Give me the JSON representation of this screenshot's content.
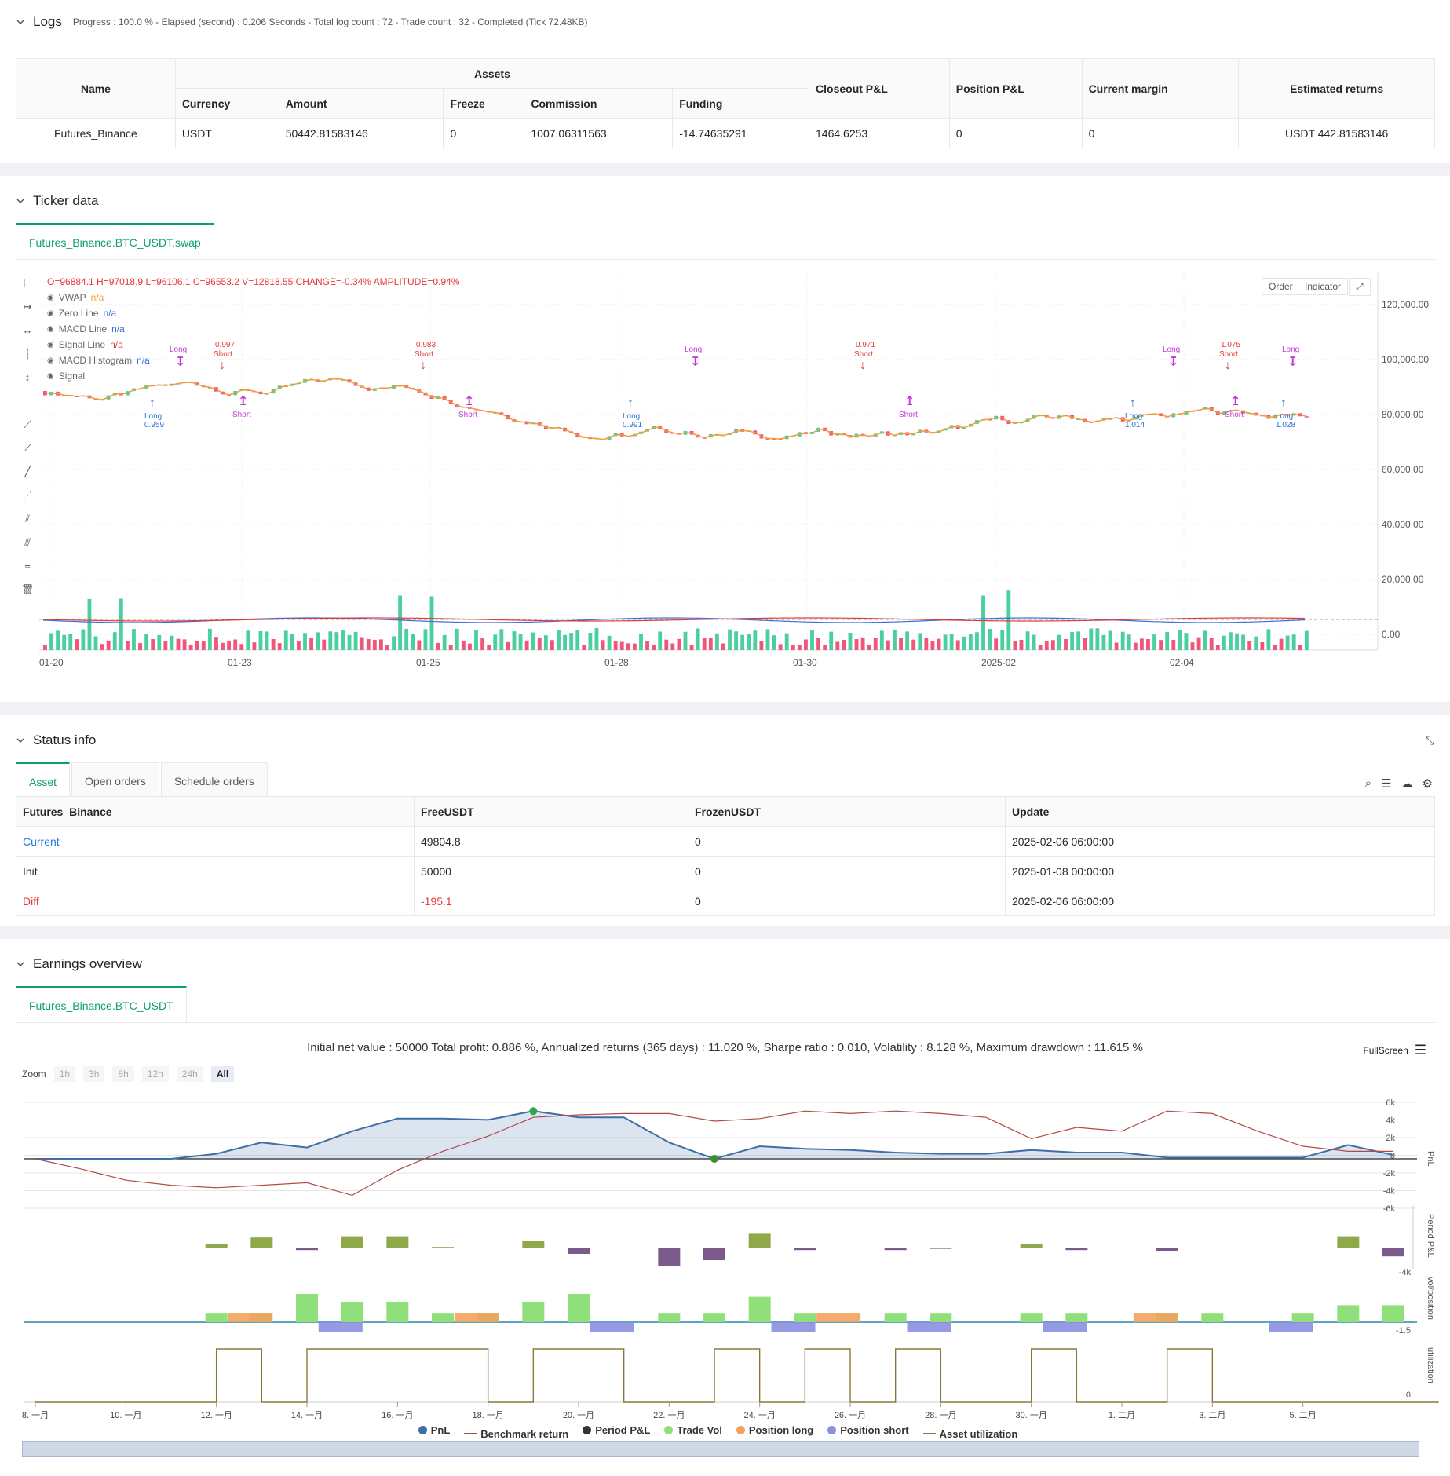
{
  "logs": {
    "title": "Logs",
    "meta": "Progress : 100.0 % - Elapsed (second) : 0.206  Seconds - Total log count : 72 - Trade count : 32 - Completed (Tick 72.48KB)"
  },
  "assets_table": {
    "group_header": "Assets",
    "headers": [
      "Name",
      "Currency",
      "Amount",
      "Freeze",
      "Commission",
      "Funding",
      "Closeout P&L",
      "Position P&L",
      "Current margin",
      "Estimated returns"
    ],
    "row": [
      "Futures_Binance",
      "USDT",
      "50442.81583146",
      "0",
      "1007.06311563",
      "-14.74635291",
      "1464.6253",
      "0",
      "0",
      "USDT 442.81583146"
    ]
  },
  "ticker": {
    "title": "Ticker data",
    "tab": "Futures_Binance.BTC_USDT.swap",
    "ohlc": "O=96884.1  H=97018.9  L=96106.1  C=96553.2  V=12818.55  CHANGE=-0.34%  AMPLITUDE=0.94%",
    "order_btn": "Order",
    "indicator_btn": "Indicator",
    "indicators": [
      {
        "name": "VWAP",
        "value": "n/a",
        "color": "#f29c38"
      },
      {
        "name": "Zero Line",
        "value": "n/a",
        "color": "#3a6ed8"
      },
      {
        "name": "MACD Line",
        "value": "n/a",
        "color": "#3a6ed8"
      },
      {
        "name": "Signal Line",
        "value": "n/a",
        "color": "#e5383b"
      },
      {
        "name": "MACD Histogram",
        "value": "n/a",
        "color": "#3a6ed8"
      },
      {
        "name": "Signal",
        "value": "",
        "color": "#666666"
      }
    ],
    "y_ticks": [
      "120,000.00",
      "100,000.00",
      "80,000.00",
      "60,000.00",
      "40,000.00",
      "20,000.00",
      "0.00"
    ],
    "x_ticks": [
      "01-20",
      "01-23",
      "01-25",
      "01-28",
      "01-30",
      "2025-02",
      "02-04"
    ],
    "signals": [
      {
        "label": "Long",
        "sub": "0.959",
        "type": "long"
      },
      {
        "label": "Short",
        "sub": "0.997",
        "type": "short"
      },
      {
        "label": "Short",
        "sub": "0.983",
        "type": "short"
      },
      {
        "label": "Long",
        "sub": "0.991",
        "type": "long"
      },
      {
        "label": "Short",
        "sub": "0.971",
        "type": "short"
      },
      {
        "label": "Long",
        "sub": "1.014",
        "type": "long"
      },
      {
        "label": "Short",
        "sub": "1.075",
        "type": "short"
      },
      {
        "label": "Long",
        "sub": "1.028",
        "type": "long"
      }
    ],
    "exits": [
      {
        "label": "Long"
      },
      {
        "label": "Short"
      },
      {
        "label": "Short"
      },
      {
        "label": "Long"
      },
      {
        "label": "Short"
      },
      {
        "label": "Long"
      },
      {
        "label": "Short"
      },
      {
        "label": "Long"
      }
    ]
  },
  "status": {
    "title": "Status info",
    "tabs": [
      "Asset",
      "Open orders",
      "Schedule orders"
    ],
    "headers": [
      "Futures_Binance",
      "FreeUSDT",
      "FrozenUSDT",
      "Update"
    ],
    "rows": [
      [
        "Current",
        "49804.8",
        "0",
        "2025-02-06 06:00:00"
      ],
      [
        "Init",
        "50000",
        "0",
        "2025-01-08 00:00:00"
      ],
      [
        "Diff",
        "-195.1",
        "0",
        "2025-02-06 06:00:00"
      ]
    ]
  },
  "earnings": {
    "title": "Earnings overview",
    "tab": "Futures_Binance.BTC_USDT",
    "summary": "Initial net value : 50000  Total profit: 0.886 %, Annualized returns (365 days) : 11.020 %, Sharpe ratio : 0.010, Volatility : 8.128 %, Maximum drawdown : 11.615 %",
    "fullscreen": "FullScreen",
    "zoom_label": "Zoom",
    "zoom_options": [
      "1h",
      "3h",
      "8h",
      "12h",
      "24h",
      "All"
    ],
    "pnl_ticks": [
      "6k",
      "4k",
      "2k",
      "0",
      "-2k",
      "-4k",
      "-6k"
    ],
    "ppl_tick": "-4k",
    "vol_tick": "-1.5",
    "util_tick": "0",
    "axis_titles": [
      "PnL",
      "Period P&L",
      "vol/position",
      "utilization"
    ],
    "x_ticks": [
      "8. 一月",
      "10. 一月",
      "12. 一月",
      "14. 一月",
      "16. 一月",
      "18. 一月",
      "20. 一月",
      "22. 一月",
      "24. 一月",
      "26. 一月",
      "28. 一月",
      "30. 一月",
      "1. 二月",
      "3. 二月",
      "5. 二月"
    ],
    "legend": [
      {
        "name": "PnL",
        "color": "#3f6ea6",
        "kind": "dot"
      },
      {
        "name": "Benchmark return",
        "color": "#b04a45",
        "kind": "line"
      },
      {
        "name": "Period P&L",
        "color": "#333333",
        "kind": "dot"
      },
      {
        "name": "Trade Vol",
        "color": "#8fe07a",
        "kind": "dot"
      },
      {
        "name": "Position long",
        "color": "#f0a35e",
        "kind": "dot"
      },
      {
        "name": "Position short",
        "color": "#8b8fe0",
        "kind": "dot"
      },
      {
        "name": "Asset utilization",
        "color": "#8a7a3a",
        "kind": "line"
      }
    ]
  },
  "colors": {
    "accent": "#0e9f6e",
    "up": "#4ccfa0",
    "down": "#f0567a",
    "pnl": "#3f6ea6",
    "benchmark": "#b04a45"
  }
}
